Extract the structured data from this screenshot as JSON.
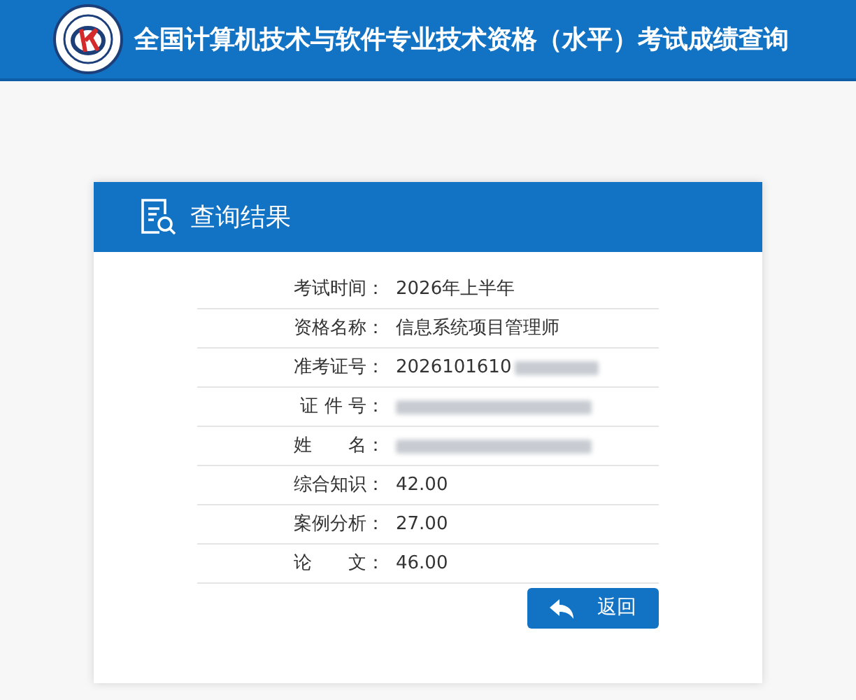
{
  "header": {
    "title": "全国计算机技术与软件专业技术资格（水平）考试成绩查询"
  },
  "panel": {
    "title": "查询结果"
  },
  "rows": [
    {
      "label": "考试时间：",
      "value": "2026年上半年"
    },
    {
      "label": "资格名称：",
      "value": "信息系统项目管理师"
    },
    {
      "label": "准考证号：",
      "value": "2026101610",
      "redacted": true
    },
    {
      "label": "证 件 号：",
      "redacted": true
    },
    {
      "label": "姓　　名：",
      "redacted": true
    },
    {
      "label": "综合知识：",
      "value": "42.00"
    },
    {
      "label": "案例分析：",
      "value": "27.00"
    },
    {
      "label": "论　　文：",
      "value": "46.00"
    }
  ],
  "back_button": {
    "label": "返回"
  }
}
